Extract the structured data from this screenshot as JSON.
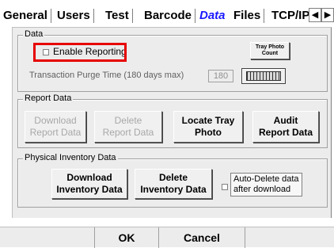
{
  "tabs": [
    {
      "label": "General",
      "active": false
    },
    {
      "label": "Users",
      "active": false
    },
    {
      "label": "Test",
      "active": false
    },
    {
      "label": "Barcode",
      "active": false
    },
    {
      "label": "Data",
      "active": true
    },
    {
      "label": "Files",
      "active": false
    },
    {
      "label": "TCP/IP",
      "active": false
    }
  ],
  "tab_nav": {
    "left_arrow": "◀",
    "right_arrow": "▶"
  },
  "data_group": {
    "title": "Data",
    "enable_reporting_label": "Enable Reporting",
    "enable_reporting_checked": false,
    "tray_photo_count_label": "Tray Photo\nCount",
    "purge_label": "Transaction Purge Time (180 days max)",
    "purge_value": "180"
  },
  "report_group": {
    "title": "Report Data",
    "download_label": "Download\nReport Data",
    "delete_label": "Delete\nReport Data",
    "locate_label": "Locate Tray\nPhoto",
    "audit_label": "Audit\nReport Data"
  },
  "inventory_group": {
    "title": "Physical Inventory Data",
    "download_label": "Download\nInventory Data",
    "delete_label": "Delete\nInventory Data",
    "auto_delete_label": "Auto-Delete data\nafter download",
    "auto_delete_checked": false
  },
  "footer": {
    "ok_label": "OK",
    "cancel_label": "Cancel"
  },
  "colors": {
    "active_tab": "#1a1aff",
    "highlight": "#e60000",
    "panel": "#ececec"
  }
}
